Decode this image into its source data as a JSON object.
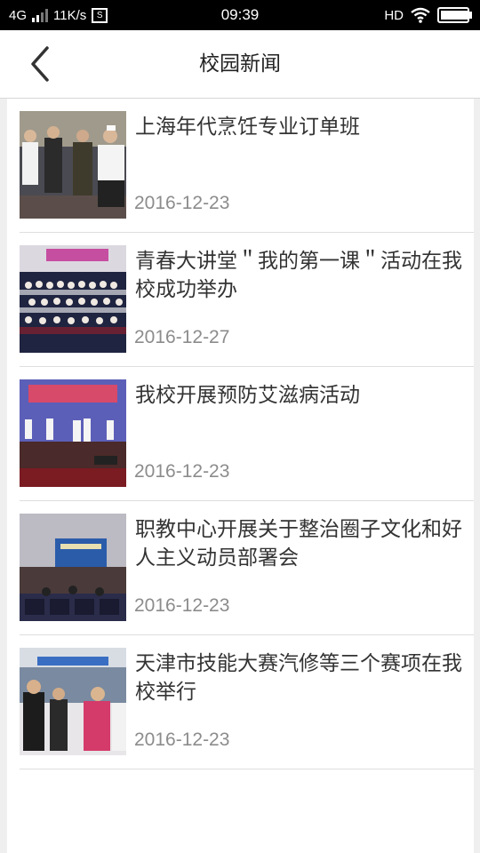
{
  "status_bar": {
    "network": "4G",
    "speed": "11K/s",
    "s_badge": "S",
    "time": "09:39",
    "hd": "HD",
    "battery_level": 0.95
  },
  "nav": {
    "title": "校园新闻",
    "back_icon": "chevron-left-icon"
  },
  "news": [
    {
      "title": "上海年代烹饪专业订单班",
      "date": "2016-12-23"
    },
    {
      "title": "青春大讲堂＂我的第一课＂活动在我校成功举办",
      "date": "2016-12-27"
    },
    {
      "title": "我校开展预防艾滋病活动",
      "date": "2016-12-23"
    },
    {
      "title": "职教中心开展关于整治圈子文化和好人主义动员部署会",
      "date": "2016-12-23"
    },
    {
      "title": "天津市技能大赛汽修等三个赛项在我校举行",
      "date": "2016-12-23"
    }
  ]
}
